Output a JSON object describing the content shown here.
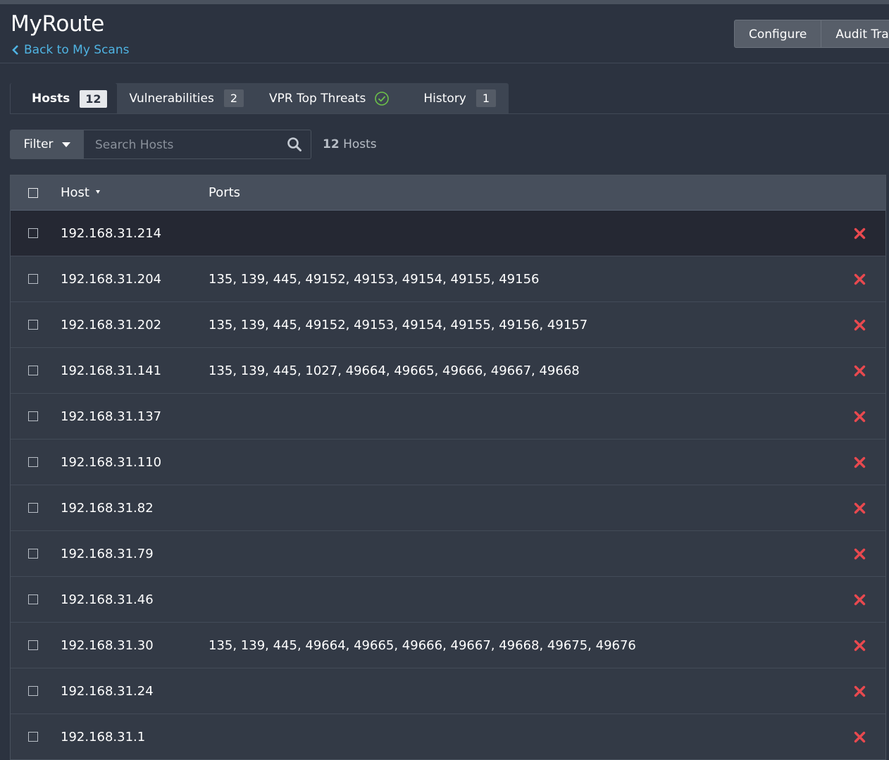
{
  "header": {
    "title": "MyRoute",
    "back_link": "Back to My Scans",
    "buttons": {
      "configure": "Configure",
      "audit_trail": "Audit Tra"
    }
  },
  "tabs": [
    {
      "label": "Hosts",
      "count": "12",
      "active": true
    },
    {
      "label": "Vulnerabilities",
      "count": "2"
    },
    {
      "label": "VPR Top Threats",
      "icon": "check-circle-icon"
    },
    {
      "label": "History",
      "count": "1"
    }
  ],
  "filter": {
    "label": "Filter",
    "search_placeholder": "Search Hosts",
    "count": "12",
    "count_label": "Hosts"
  },
  "table": {
    "columns": {
      "host": "Host",
      "ports": "Ports"
    },
    "rows": [
      {
        "host": "192.168.31.214",
        "ports": ""
      },
      {
        "host": "192.168.31.204",
        "ports": "135, 139, 445, 49152, 49153, 49154, 49155, 49156"
      },
      {
        "host": "192.168.31.202",
        "ports": "135, 139, 445, 49152, 49153, 49154, 49155, 49156, 49157"
      },
      {
        "host": "192.168.31.141",
        "ports": "135, 139, 445, 1027, 49664, 49665, 49666, 49667, 49668"
      },
      {
        "host": "192.168.31.137",
        "ports": ""
      },
      {
        "host": "192.168.31.110",
        "ports": ""
      },
      {
        "host": "192.168.31.82",
        "ports": ""
      },
      {
        "host": "192.168.31.79",
        "ports": ""
      },
      {
        "host": "192.168.31.46",
        "ports": ""
      },
      {
        "host": "192.168.31.30",
        "ports": "135, 139, 445, 49664, 49665, 49666, 49667, 49668, 49675, 49676"
      },
      {
        "host": "192.168.31.24",
        "ports": ""
      },
      {
        "host": "192.168.31.1",
        "ports": ""
      }
    ]
  },
  "colors": {
    "accent_link": "#4fb4e3",
    "delete": "#e8494f",
    "success": "#6cc04a"
  }
}
